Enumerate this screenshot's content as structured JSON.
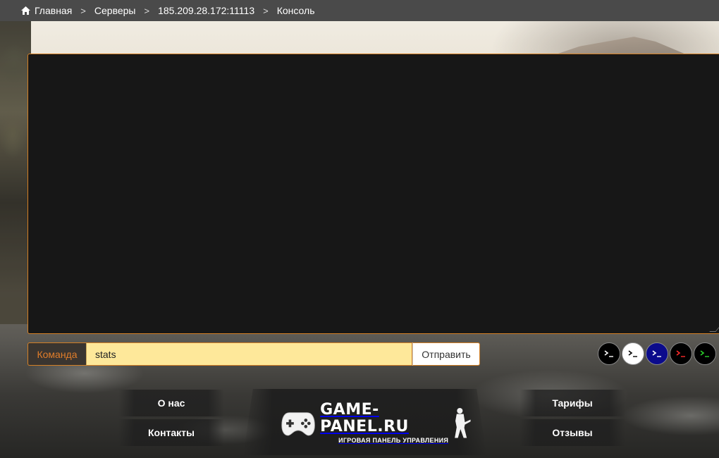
{
  "breadcrumb": {
    "items": [
      {
        "label": "Главная",
        "icon": "home-icon"
      },
      {
        "label": "Серверы"
      },
      {
        "label": "185.209.28.172:11113"
      },
      {
        "label": "Консоль"
      }
    ],
    "separator": ">"
  },
  "console": {
    "output": ""
  },
  "command": {
    "label": "Команда",
    "value": "stats",
    "placeholder": "",
    "send_label": "Отправить"
  },
  "themes": [
    {
      "name": "black",
      "bg": "#000000",
      "fg": "#ffffff"
    },
    {
      "name": "white",
      "bg": "#ffffff",
      "fg": "#000000"
    },
    {
      "name": "blue",
      "bg": "#0b0b8c",
      "fg": "#ffffff"
    },
    {
      "name": "red",
      "bg": "#000000",
      "fg": "#ff2a2a"
    },
    {
      "name": "green",
      "bg": "#000000",
      "fg": "#2bd12b"
    }
  ],
  "footer": {
    "about": "О нас",
    "contacts": "Контакты",
    "tariffs": "Тарифы",
    "reviews": "Отзывы",
    "logo_title": "GAME-PANEL.RU",
    "logo_subtitle": "ИГРОВАЯ ПАНЕЛЬ УПРАВЛЕНИЯ"
  },
  "colors": {
    "accent": "#d48025",
    "input_bg": "#fee89a",
    "console_bg": "#171717",
    "topbar_bg": "#4a4a4a"
  }
}
